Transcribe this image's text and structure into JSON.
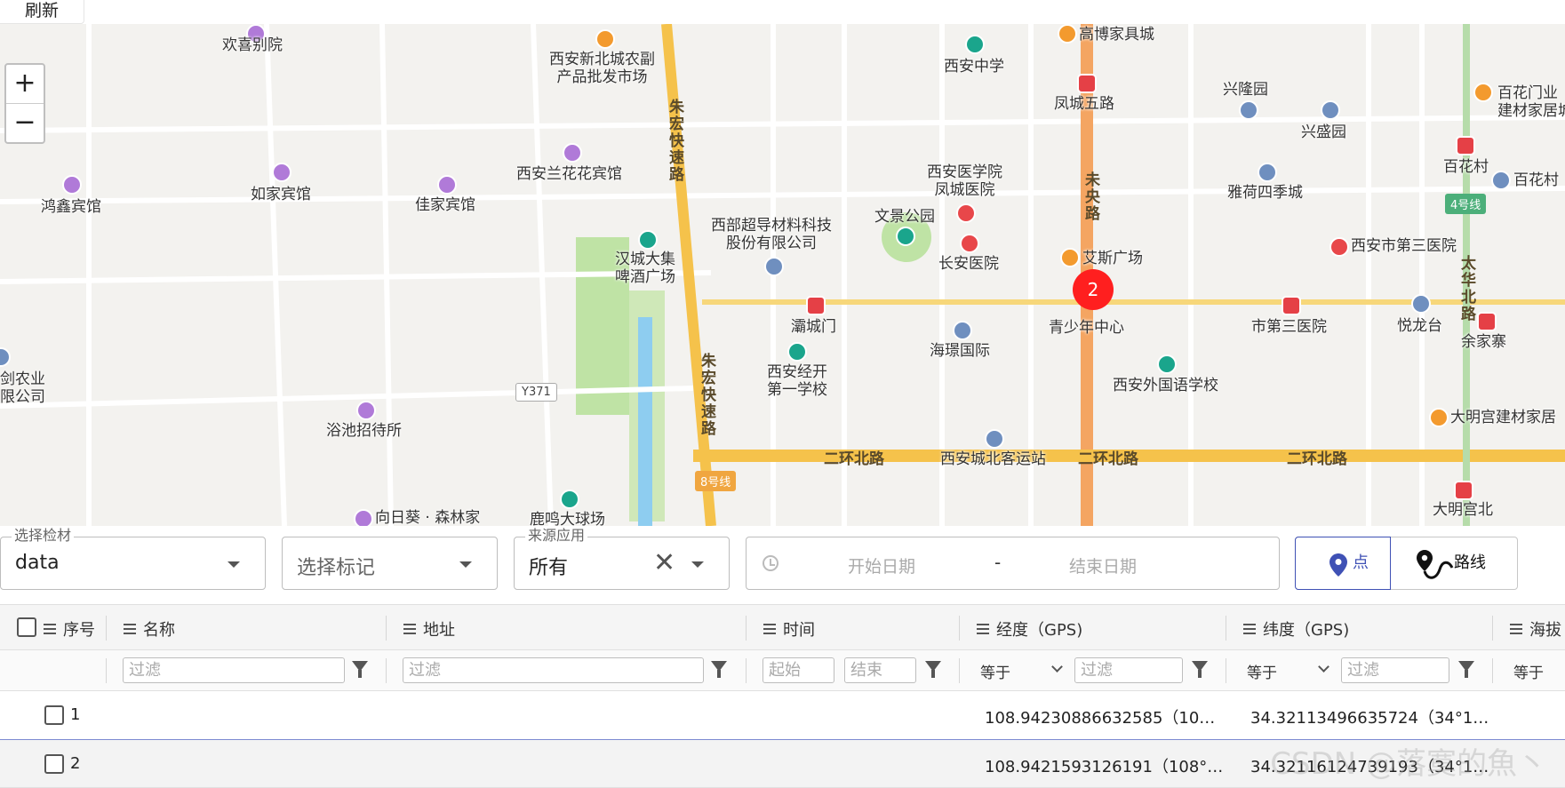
{
  "toolbar": {
    "refresh_label": "刷新"
  },
  "map": {
    "zoom_in": "+",
    "zoom_out": "−",
    "marker_count": "2",
    "pois": {
      "huanxi": "欢喜别院",
      "xinbeicheng": "西安新北城农副\n产品批发市场",
      "gaobo": "高博家具城",
      "xian_middle": "西安中学",
      "xinglong": "兴隆园",
      "baihuamen": "百花门业\n建材家居城",
      "fengcheng5": "凤城五路",
      "xingsheng": "兴盛园",
      "hongxin": "鸿鑫宾馆",
      "rujia": "如家宾馆",
      "jiajia": "佳家宾馆",
      "lanhuahua": "西安兰花花宾馆",
      "yixueyuan": "西安医学院\n凤城医院",
      "baihuacun": "百花村",
      "yahe": "雅荷四季城",
      "baihuacun2": "百花村",
      "xibu": "西部超导材料科技\n股份有限公司",
      "wenjing": "文景公园",
      "changan": "长安医院",
      "aisi": "艾斯广场",
      "hancheng": "汉城大集\n啤酒广场",
      "third_hosp": "西安市第三医院",
      "bachengmen": "灞城门",
      "haiying": "海璟国际",
      "qingshaonian": "青少年中心",
      "shidisan": "市第三医院",
      "yuelongtai": "悦龙台",
      "yujiazhai": "余家寨",
      "jingkai": "西安经开\n第一学校",
      "waiguoyu": "西安外国语学校",
      "nongye": "剑农业\n限公司",
      "yuchi": "浴池招待所",
      "daminggong_jc": "大明宫建材家居",
      "keyunzhan": "西安城北客运站",
      "xiangrikui": "向日葵 · 森林家",
      "luming": "鹿鸣大球场",
      "daminggong": "大明宫北"
    },
    "roads": {
      "zhuhong1": "朱宏快速路",
      "zhuhong2": "朱宏快速路",
      "weiyang": "未央路",
      "taihua": "太华北路",
      "erhuan1": "二环北路",
      "erhuan2": "二环北路",
      "erhuan3": "二环北路",
      "y371": "Y371",
      "line8": "8号线",
      "line4": "4号线"
    }
  },
  "filters": {
    "material": {
      "legend": "选择检材",
      "value": "data"
    },
    "tag": {
      "placeholder": "选择标记"
    },
    "source": {
      "legend": "来源应用",
      "value": "所有"
    },
    "date": {
      "start_placeholder": "开始日期",
      "separator": "-",
      "end_placeholder": "结束日期"
    },
    "mode": {
      "point_label": "点",
      "route_label": "路线"
    }
  },
  "table": {
    "columns": [
      "序号",
      "名称",
      "地址",
      "时间",
      "经度（GPS)",
      "纬度（GPS)",
      "海拔"
    ],
    "filter_row": {
      "name_placeholder": "过滤",
      "address_placeholder": "过滤",
      "time_start": "起始",
      "time_end": "结束",
      "lng_op": "等于",
      "lng_placeholder": "过滤",
      "lat_op": "等于",
      "lat_placeholder": "过滤",
      "alt_op": "等于"
    },
    "rows": [
      {
        "index": "1",
        "lng": "108.94230886632585（10…",
        "lat": "34.32113496635724（34°1…"
      },
      {
        "index": "2",
        "lng": "108.9421593126191（108°…",
        "lat": "34.32116124739193（34°1…"
      }
    ]
  },
  "watermark": "CSDN @落寞的魚丶"
}
